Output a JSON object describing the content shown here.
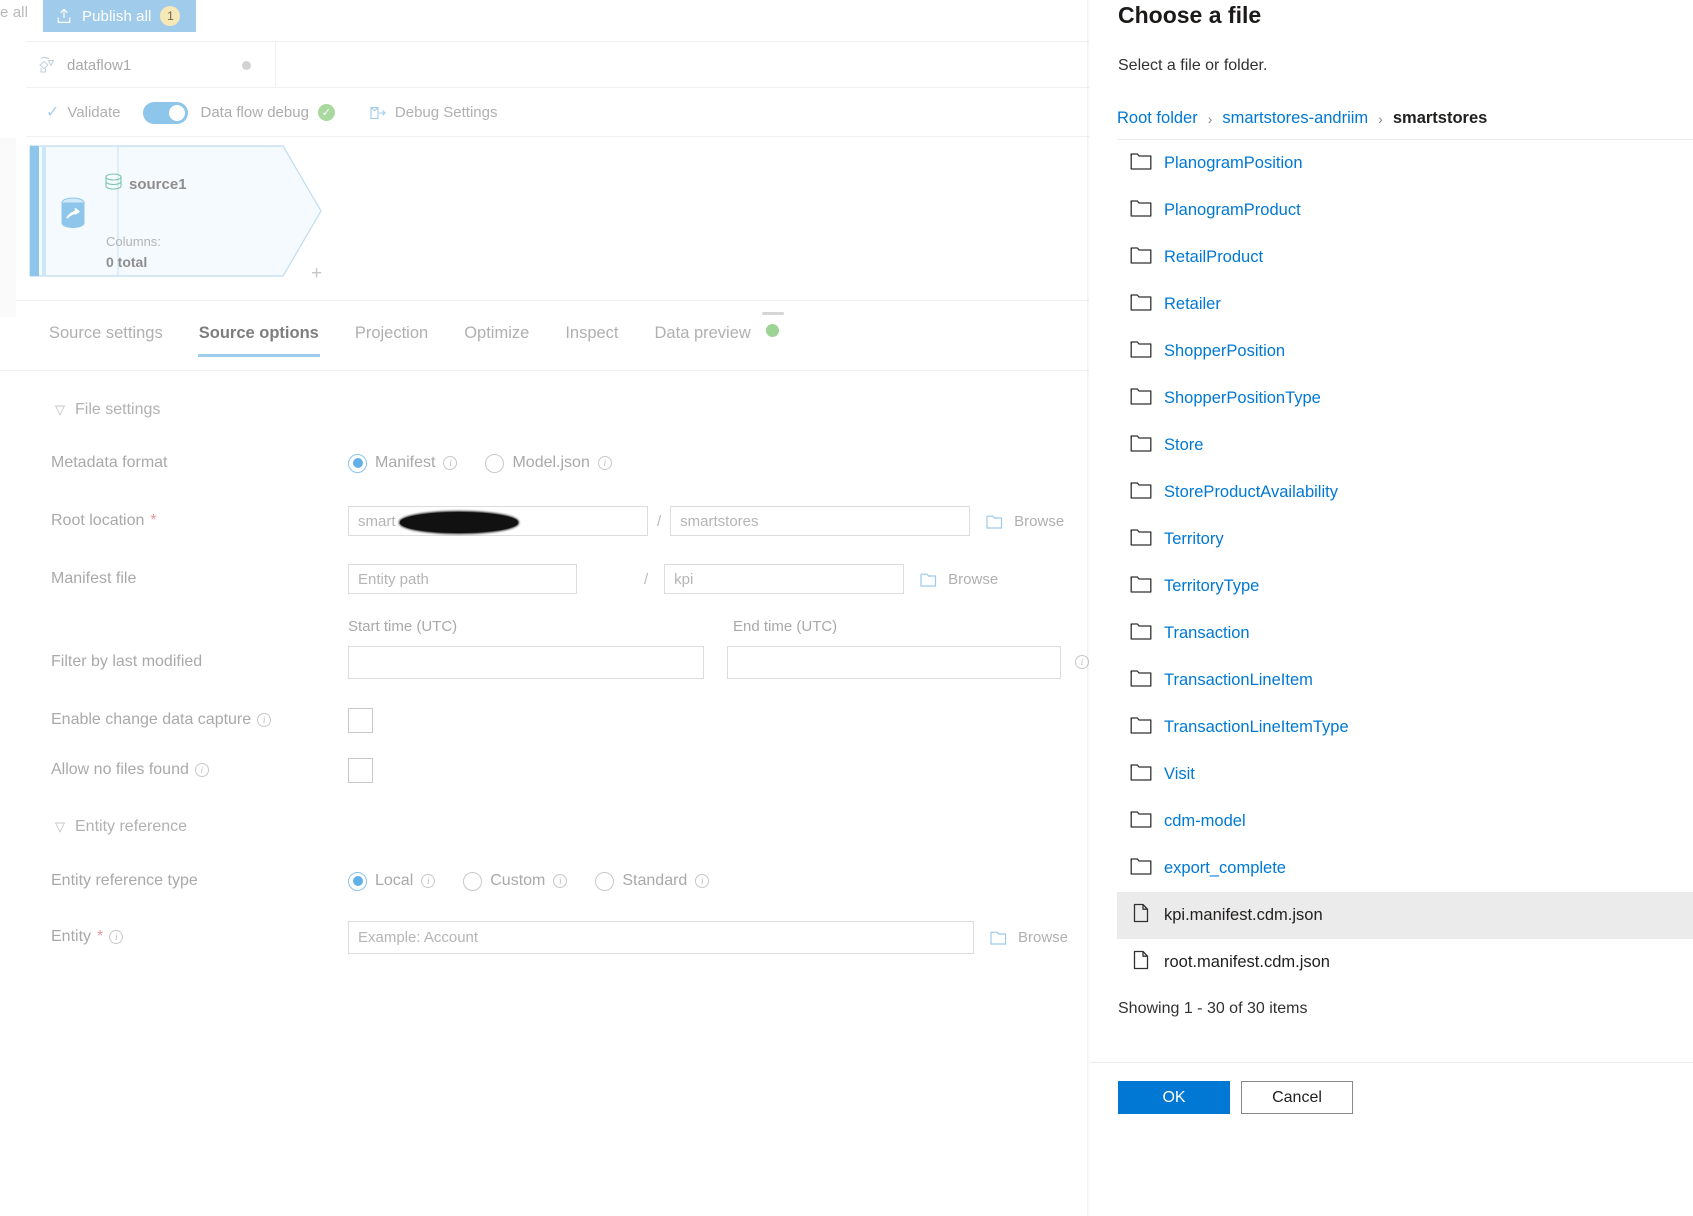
{
  "command_bar": {
    "fade_label": "e all",
    "publish_all_label": "Publish all",
    "publish_all_badge": "1",
    "publish_icon": "publish-upload-icon"
  },
  "dataflow_tab": {
    "name": "dataflow1",
    "icon": "dataflow-icon",
    "status_dot": "unsaved-dot"
  },
  "toolbar": {
    "validate_label": "Validate",
    "validate_icon": "check-icon",
    "debug_toggle_label": "Data flow debug",
    "debug_toggle_state": "on",
    "debug_status_icon": "success-check-icon",
    "debug_settings_label": "Debug Settings",
    "debug_settings_icon": "debug-settings-icon"
  },
  "canvas": {
    "node": {
      "title": "source1",
      "title_icon": "source-dataset-icon",
      "stream_icon": "source-stream-icon",
      "columns_label": "Columns:",
      "columns_value": "0 total",
      "add_icon": "+"
    }
  },
  "tabs": [
    {
      "label": "Source settings",
      "active": false
    },
    {
      "label": "Source options",
      "active": true
    },
    {
      "label": "Projection",
      "active": false
    },
    {
      "label": "Optimize",
      "active": false
    },
    {
      "label": "Inspect",
      "active": false
    },
    {
      "label": "Data preview",
      "active": false,
      "dot": "green-status-dot"
    }
  ],
  "form": {
    "file_settings_header": "File settings",
    "entity_reference_header": "Entity reference",
    "metadata_format": {
      "label": "Metadata format",
      "options": [
        {
          "label": "Manifest",
          "selected": true
        },
        {
          "label": "Model.json",
          "selected": false
        }
      ]
    },
    "root_location": {
      "label": "Root location",
      "required": "*",
      "container_value": "smart",
      "container_redacted": true,
      "separator": "/",
      "folder_value": "smartstores",
      "browse_label": "Browse"
    },
    "manifest_file": {
      "label": "Manifest file",
      "entity_path_placeholder": "Entity path",
      "separator": "/",
      "file_value": "kpi",
      "browse_label": "Browse"
    },
    "filter_by_last_modified": {
      "label": "Filter by last modified",
      "start_label": "Start time (UTC)",
      "end_label": "End time (UTC)",
      "start_value": "",
      "end_value": ""
    },
    "enable_cdc": {
      "label": "Enable change data capture",
      "checked": false
    },
    "allow_no_files": {
      "label": "Allow no files found",
      "checked": false
    },
    "entity_reference_type": {
      "label": "Entity reference type",
      "options": [
        {
          "label": "Local",
          "selected": true
        },
        {
          "label": "Custom",
          "selected": false
        },
        {
          "label": "Standard",
          "selected": false
        }
      ]
    },
    "entity": {
      "label": "Entity",
      "required": "*",
      "placeholder": "Example: Account",
      "browse_label": "Browse"
    }
  },
  "dialog": {
    "title": "Choose a file",
    "subtitle": "Select a file or folder.",
    "breadcrumb": [
      {
        "label": "Root folder",
        "current": false
      },
      {
        "label": "smartstores-andriim",
        "current": false
      },
      {
        "label": "smartstores",
        "current": true
      }
    ],
    "breadcrumb_separator": "›",
    "items": [
      {
        "name": "PlanogramPosition",
        "type": "folder",
        "selected": false
      },
      {
        "name": "PlanogramProduct",
        "type": "folder",
        "selected": false
      },
      {
        "name": "RetailProduct",
        "type": "folder",
        "selected": false
      },
      {
        "name": "Retailer",
        "type": "folder",
        "selected": false
      },
      {
        "name": "ShopperPosition",
        "type": "folder",
        "selected": false
      },
      {
        "name": "ShopperPositionType",
        "type": "folder",
        "selected": false
      },
      {
        "name": "Store",
        "type": "folder",
        "selected": false
      },
      {
        "name": "StoreProductAvailability",
        "type": "folder",
        "selected": false
      },
      {
        "name": "Territory",
        "type": "folder",
        "selected": false
      },
      {
        "name": "TerritoryType",
        "type": "folder",
        "selected": false
      },
      {
        "name": "Transaction",
        "type": "folder",
        "selected": false
      },
      {
        "name": "TransactionLineItem",
        "type": "folder",
        "selected": false
      },
      {
        "name": "TransactionLineItemType",
        "type": "folder",
        "selected": false
      },
      {
        "name": "Visit",
        "type": "folder",
        "selected": false
      },
      {
        "name": "cdm-model",
        "type": "folder",
        "selected": false
      },
      {
        "name": "export_complete",
        "type": "folder",
        "selected": false
      },
      {
        "name": "kpi.manifest.cdm.json",
        "type": "file",
        "selected": true
      },
      {
        "name": "root.manifest.cdm.json",
        "type": "file",
        "selected": false
      }
    ],
    "showing_text": "Showing 1 - 30 of 30 items",
    "ok_label": "OK",
    "cancel_label": "Cancel"
  },
  "colors": {
    "accent_blue": "#0078d4",
    "link_blue": "#0078d4",
    "publish_bar": "#a0cbeb",
    "badge": "#f7e8b8",
    "tab_underline": "#9fcdee",
    "status_green": "#9dd394",
    "selected_row": "#ebebeb"
  }
}
